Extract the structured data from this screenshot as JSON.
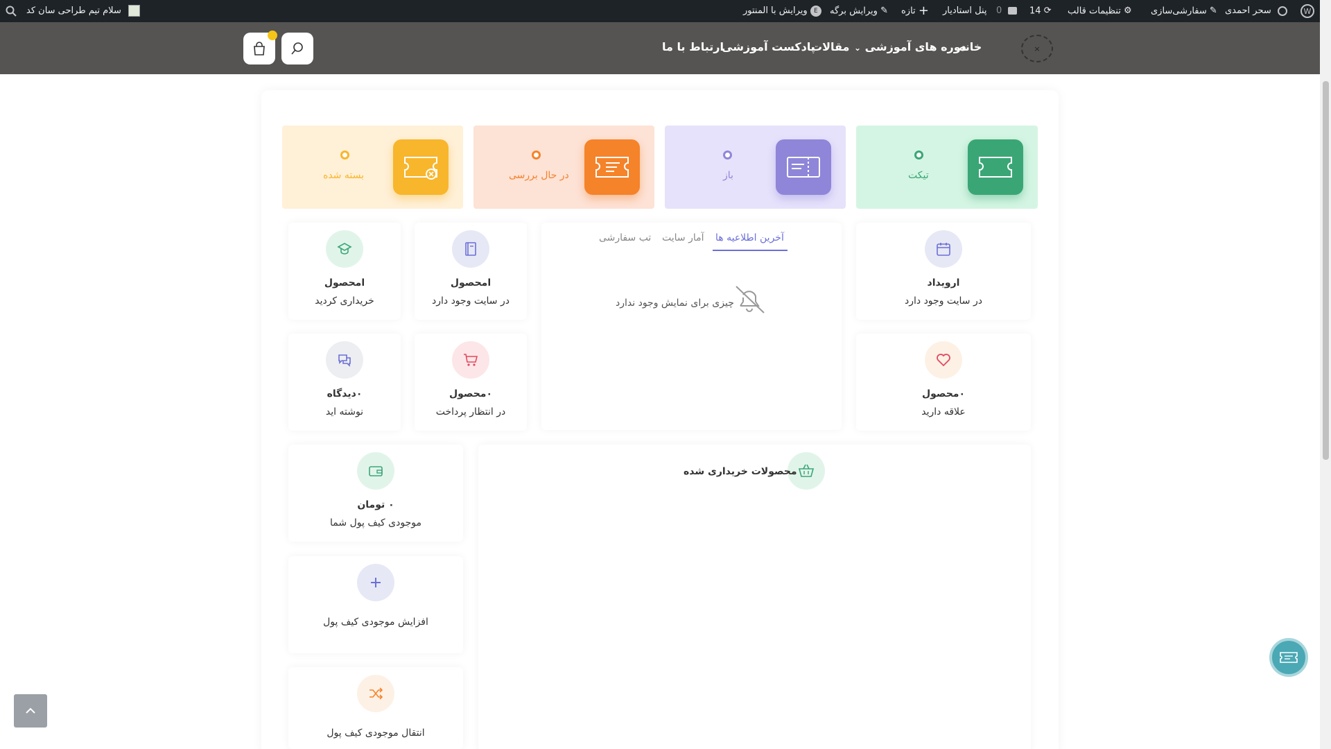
{
  "adminbar": {
    "user": "سحر احمدی",
    "customize": "سفارشی‌سازی",
    "theme_settings": "تنظیمات قالب",
    "updates_count": "14",
    "comments_count": "0",
    "panel": "پنل استادیار",
    "new": "تازه",
    "edit_page": "ویرایش برگه",
    "edit_elementor": "ویرایش با المنتور",
    "greeting": "سلام تیم طراحی سان کد"
  },
  "nav": {
    "home": "خانه",
    "courses": "دوره های آموزشی",
    "articles": "مقالات",
    "podcast": "پادکست آموزشی",
    "contact": "ارتباط با ما",
    "logo_text": "×"
  },
  "tickets": [
    {
      "label": "تیکت",
      "color": "#3aa676",
      "bg": "#d4f5e3",
      "dot": "#3aa676"
    },
    {
      "label": "باز",
      "color": "#8f86d9",
      "bg": "#e6e2fb",
      "dot": "#8f86d9"
    },
    {
      "label": "در حال بررسی",
      "color": "#f5832a",
      "bg": "#fde2d6",
      "dot": "#f5832a"
    },
    {
      "label": "بسته شده",
      "color": "#f8b62c",
      "bg": "#fff0d8",
      "dot": "#f8b62c"
    }
  ],
  "cards": {
    "events": {
      "t1": "ارویداد",
      "t2": "در سایت وجود دارد"
    },
    "favorites": {
      "t1": "۰محصول",
      "t2": "علاقه دارید"
    },
    "products_exist": {
      "t1": "امحصول",
      "t2": "در سایت وجود دارد"
    },
    "products_bought": {
      "t1": "امحصول",
      "t2": "خریداری کردید"
    },
    "pending": {
      "t1": "۰محصول",
      "t2": "در انتظار پرداخت"
    },
    "comments": {
      "t1": "۰دیدگاه",
      "t2": "نوشته اید"
    },
    "wallet": {
      "t1": "۰ تومان",
      "t2": "موجودی کیف پول شما"
    },
    "wallet_add": {
      "t2": "افزایش موجودی کیف پول"
    },
    "wallet_transfer": {
      "t2": "انتقال موجودی کیف پول"
    }
  },
  "tabs": {
    "latest": "آخرین اطلاعیه ها",
    "stats": "آمار سایت",
    "custom": "تب سفارشی",
    "empty": "چیزی برای نمایش وجود ندارد"
  },
  "purchased": {
    "title": "محصولات خریداری شده"
  },
  "accent": "#6b6fd8"
}
